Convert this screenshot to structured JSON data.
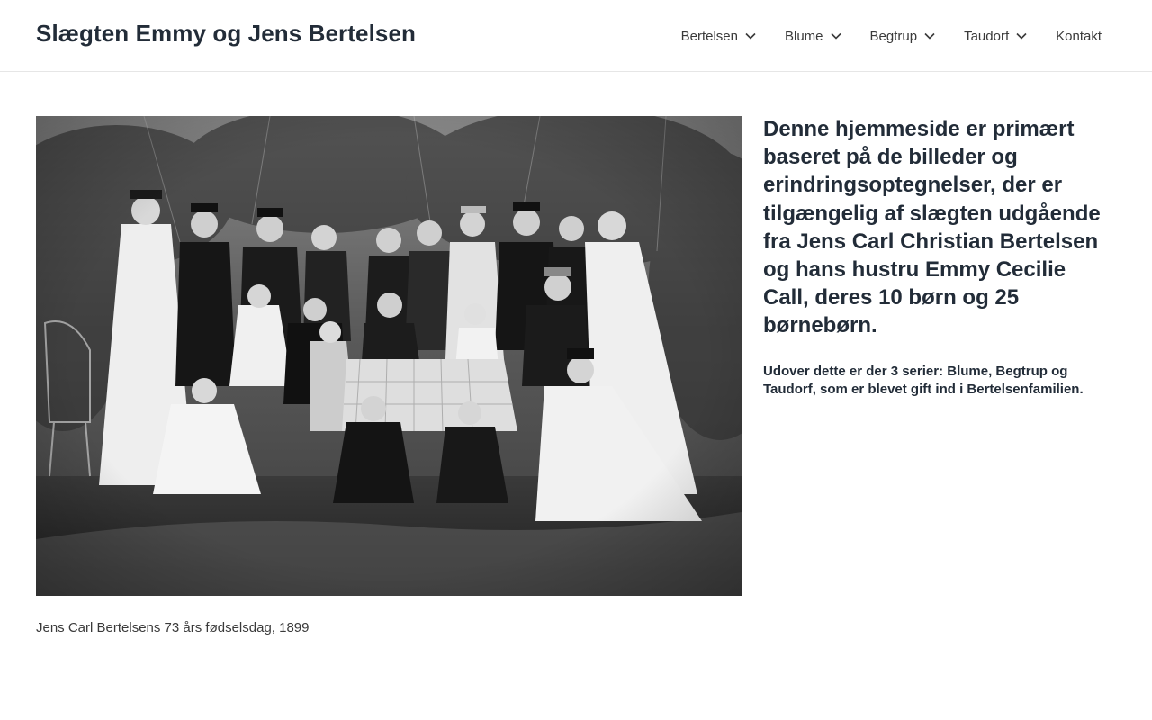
{
  "site": {
    "title": "Slægten Emmy og Jens Bertelsen"
  },
  "nav": {
    "items": [
      {
        "label": "Bertelsen",
        "has_submenu": true
      },
      {
        "label": "Blume",
        "has_submenu": true
      },
      {
        "label": "Begtrup",
        "has_submenu": true
      },
      {
        "label": "Taudorf",
        "has_submenu": true
      },
      {
        "label": "Kontakt",
        "has_submenu": false
      }
    ]
  },
  "main": {
    "photo": {
      "description_icon": "family-photo",
      "caption": "Jens Carl Bertelsens 73 års fødselsdag, 1899"
    },
    "intro": "Denne hjemmeside er primært baseret på de billeder og erindringsoptegnelser, der er tilgængelig af slægten udgående fra Jens Carl Christian Bertelsen og hans hustru Emmy Cecilie Call, deres 10 børn og 25 børnebørn.",
    "note": "Udover dette er der 3 serier: Blume, Begtrup og Taudorf, som er blevet gift ind i Bertelsenfamilien."
  },
  "colors": {
    "heading": "#222c38",
    "text": "#3a3a3a",
    "border": "#e6e6e6",
    "background": "#ffffff"
  }
}
